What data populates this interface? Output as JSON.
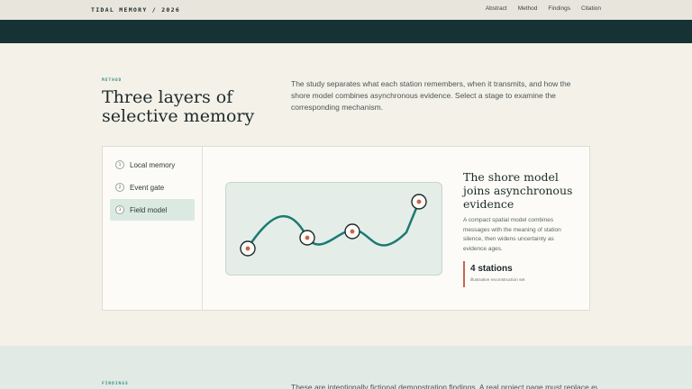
{
  "header": {
    "brand": "TIDAL MEMORY / 2026",
    "nav": [
      "Abstract",
      "Method",
      "Findings",
      "Citation"
    ]
  },
  "method": {
    "eyebrow": "METHOD",
    "title": "Three layers of selective memory",
    "lede": "The study separates what each station remembers, when it transmits, and how the shore model combines asynchronous evidence. Select a stage to examine the corresponding mechanism.",
    "steps": [
      {
        "num": "1",
        "label": "Local memory",
        "active": false
      },
      {
        "num": "2",
        "label": "Event gate",
        "active": false
      },
      {
        "num": "3",
        "label": "Field model",
        "active": true
      }
    ],
    "detail": {
      "title": "The shore model joins asynchronous evidence",
      "description": "A compact spatial model combines messages with the meaning of station silence, then widens uncertainty as evidence ages.",
      "stat_value": "4 stations",
      "stat_label": "illustrative reconstruction set"
    }
  },
  "findings": {
    "eyebrow": "FINDINGS",
    "lede": "These are intentionally fictional demonstration findings. A real project page must replace every"
  },
  "colors": {
    "accent": "#1b7a72",
    "marker": "#c9634f",
    "dark_band": "#163234"
  }
}
